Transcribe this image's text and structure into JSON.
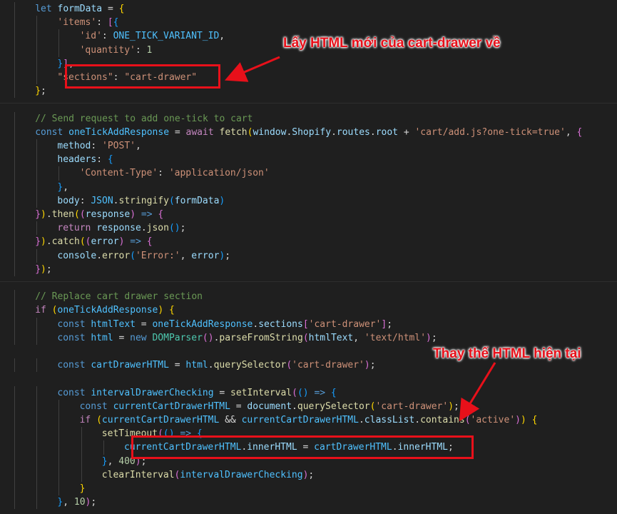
{
  "lines": [
    {
      "indent": 2,
      "tokens": [
        [
          "kw",
          "let"
        ],
        [
          "p",
          " "
        ],
        [
          "var",
          "formData"
        ],
        [
          "p",
          " = "
        ],
        [
          "b1",
          "{"
        ]
      ]
    },
    {
      "indent": 3,
      "tokens": [
        [
          "str",
          "'items'"
        ],
        [
          "p",
          ": "
        ],
        [
          "b2",
          "["
        ],
        [
          "b3",
          "{"
        ]
      ]
    },
    {
      "indent": 4,
      "tokens": [
        [
          "str",
          "'id'"
        ],
        [
          "p",
          ": "
        ],
        [
          "cst",
          "ONE_TICK_VARIANT_ID"
        ],
        [
          "p",
          ","
        ]
      ]
    },
    {
      "indent": 4,
      "tokens": [
        [
          "str",
          "'quantity'"
        ],
        [
          "p",
          ": "
        ],
        [
          "num",
          "1"
        ]
      ]
    },
    {
      "indent": 3,
      "tokens": [
        [
          "b3",
          "}"
        ],
        [
          "b2",
          "]"
        ],
        [
          "p",
          ","
        ]
      ]
    },
    {
      "indent": 3,
      "tokens": [
        [
          "str",
          "\"sections\""
        ],
        [
          "p",
          ": "
        ],
        [
          "str",
          "\"cart-drawer\""
        ]
      ]
    },
    {
      "indent": 2,
      "tokens": [
        [
          "b1",
          "}"
        ],
        [
          "p",
          ";"
        ]
      ]
    },
    {
      "indent": 0,
      "tokens": []
    },
    {
      "indent": 2,
      "tokens": [
        [
          "cmt",
          "// Send request to add one-tick to cart"
        ]
      ]
    },
    {
      "indent": 2,
      "tokens": [
        [
          "kw",
          "const"
        ],
        [
          "p",
          " "
        ],
        [
          "cst",
          "oneTickAddResponse"
        ],
        [
          "p",
          " = "
        ],
        [
          "ctl",
          "await"
        ],
        [
          "p",
          " "
        ],
        [
          "fn",
          "fetch"
        ],
        [
          "b1",
          "("
        ],
        [
          "var",
          "window"
        ],
        [
          "p",
          "."
        ],
        [
          "var",
          "Shopify"
        ],
        [
          "p",
          "."
        ],
        [
          "var",
          "routes"
        ],
        [
          "p",
          "."
        ],
        [
          "var",
          "root"
        ],
        [
          "p",
          " + "
        ],
        [
          "str",
          "'cart/add.js?one-tick=true'"
        ],
        [
          "p",
          ", "
        ],
        [
          "b2",
          "{"
        ]
      ]
    },
    {
      "indent": 3,
      "tokens": [
        [
          "var",
          "method"
        ],
        [
          "p",
          ": "
        ],
        [
          "str",
          "'POST'"
        ],
        [
          "p",
          ","
        ]
      ]
    },
    {
      "indent": 3,
      "tokens": [
        [
          "var",
          "headers"
        ],
        [
          "p",
          ": "
        ],
        [
          "b3",
          "{"
        ]
      ]
    },
    {
      "indent": 4,
      "tokens": [
        [
          "str",
          "'Content-Type'"
        ],
        [
          "p",
          ": "
        ],
        [
          "str",
          "'application/json'"
        ]
      ]
    },
    {
      "indent": 3,
      "tokens": [
        [
          "b3",
          "}"
        ],
        [
          "p",
          ","
        ]
      ]
    },
    {
      "indent": 3,
      "tokens": [
        [
          "var",
          "body"
        ],
        [
          "p",
          ": "
        ],
        [
          "cst",
          "JSON"
        ],
        [
          "p",
          "."
        ],
        [
          "fn",
          "stringify"
        ],
        [
          "b3",
          "("
        ],
        [
          "var",
          "formData"
        ],
        [
          "b3",
          ")"
        ]
      ]
    },
    {
      "indent": 2,
      "tokens": [
        [
          "b2",
          "}"
        ],
        [
          "b1",
          ")"
        ],
        [
          "p",
          "."
        ],
        [
          "fn",
          "then"
        ],
        [
          "b1",
          "("
        ],
        [
          "b2",
          "("
        ],
        [
          "var",
          "response"
        ],
        [
          "b2",
          ")"
        ],
        [
          "p",
          " "
        ],
        [
          "kw",
          "=>"
        ],
        [
          "p",
          " "
        ],
        [
          "b2",
          "{"
        ]
      ]
    },
    {
      "indent": 3,
      "tokens": [
        [
          "ctl",
          "return"
        ],
        [
          "p",
          " "
        ],
        [
          "var",
          "response"
        ],
        [
          "p",
          "."
        ],
        [
          "fn",
          "json"
        ],
        [
          "b3",
          "()"
        ],
        [
          "p",
          ";"
        ]
      ]
    },
    {
      "indent": 2,
      "tokens": [
        [
          "b2",
          "}"
        ],
        [
          "b1",
          ")"
        ],
        [
          "p",
          "."
        ],
        [
          "fn",
          "catch"
        ],
        [
          "b1",
          "("
        ],
        [
          "b2",
          "("
        ],
        [
          "var",
          "error"
        ],
        [
          "b2",
          ")"
        ],
        [
          "p",
          " "
        ],
        [
          "kw",
          "=>"
        ],
        [
          "p",
          " "
        ],
        [
          "b2",
          "{"
        ]
      ]
    },
    {
      "indent": 3,
      "tokens": [
        [
          "var",
          "console"
        ],
        [
          "p",
          "."
        ],
        [
          "fn",
          "error"
        ],
        [
          "b3",
          "("
        ],
        [
          "str",
          "'Error:'"
        ],
        [
          "p",
          ", "
        ],
        [
          "var",
          "error"
        ],
        [
          "b3",
          ")"
        ],
        [
          "p",
          ";"
        ]
      ]
    },
    {
      "indent": 2,
      "tokens": [
        [
          "b2",
          "}"
        ],
        [
          "b1",
          ")"
        ],
        [
          "p",
          ";"
        ]
      ]
    },
    {
      "indent": 0,
      "tokens": []
    },
    {
      "indent": 2,
      "tokens": [
        [
          "cmt",
          "// Replace cart drawer section"
        ]
      ]
    },
    {
      "indent": 2,
      "tokens": [
        [
          "ctl",
          "if"
        ],
        [
          "p",
          " "
        ],
        [
          "b1",
          "("
        ],
        [
          "cst",
          "oneTickAddResponse"
        ],
        [
          "b1",
          ")"
        ],
        [
          "p",
          " "
        ],
        [
          "b1",
          "{"
        ]
      ]
    },
    {
      "indent": 3,
      "tokens": [
        [
          "kw",
          "const"
        ],
        [
          "p",
          " "
        ],
        [
          "cst",
          "htmlText"
        ],
        [
          "p",
          " = "
        ],
        [
          "cst",
          "oneTickAddResponse"
        ],
        [
          "p",
          "."
        ],
        [
          "var",
          "sections"
        ],
        [
          "b2",
          "["
        ],
        [
          "str",
          "'cart-drawer'"
        ],
        [
          "b2",
          "]"
        ],
        [
          "p",
          ";"
        ]
      ]
    },
    {
      "indent": 3,
      "tokens": [
        [
          "kw",
          "const"
        ],
        [
          "p",
          " "
        ],
        [
          "cst",
          "html"
        ],
        [
          "p",
          " = "
        ],
        [
          "kw",
          "new"
        ],
        [
          "p",
          " "
        ],
        [
          "cls",
          "DOMParser"
        ],
        [
          "b2",
          "()"
        ],
        [
          "p",
          "."
        ],
        [
          "fn",
          "parseFromString"
        ],
        [
          "b2",
          "("
        ],
        [
          "var",
          "htmlText"
        ],
        [
          "p",
          ", "
        ],
        [
          "str",
          "'text/html'"
        ],
        [
          "b2",
          ")"
        ],
        [
          "p",
          ";"
        ]
      ]
    },
    {
      "indent": 0,
      "tokens": []
    },
    {
      "indent": 3,
      "tokens": [
        [
          "kw",
          "const"
        ],
        [
          "p",
          " "
        ],
        [
          "cst",
          "cartDrawerHTML"
        ],
        [
          "p",
          " = "
        ],
        [
          "cst",
          "html"
        ],
        [
          "p",
          "."
        ],
        [
          "fn",
          "querySelector"
        ],
        [
          "b2",
          "("
        ],
        [
          "str",
          "'cart-drawer'"
        ],
        [
          "b2",
          ")"
        ],
        [
          "p",
          ";"
        ]
      ]
    },
    {
      "indent": 0,
      "tokens": []
    },
    {
      "indent": 3,
      "tokens": [
        [
          "kw",
          "const"
        ],
        [
          "p",
          " "
        ],
        [
          "cst",
          "intervalDrawerChecking"
        ],
        [
          "p",
          " = "
        ],
        [
          "fn",
          "setInterval"
        ],
        [
          "b2",
          "("
        ],
        [
          "b3",
          "()"
        ],
        [
          "p",
          " "
        ],
        [
          "kw",
          "=>"
        ],
        [
          "p",
          " "
        ],
        [
          "b3",
          "{"
        ]
      ]
    },
    {
      "indent": 4,
      "tokens": [
        [
          "kw",
          "const"
        ],
        [
          "p",
          " "
        ],
        [
          "cst",
          "currentCartDrawerHTML"
        ],
        [
          "p",
          " = "
        ],
        [
          "var",
          "document"
        ],
        [
          "p",
          "."
        ],
        [
          "fn",
          "querySelector"
        ],
        [
          "b1",
          "("
        ],
        [
          "str",
          "'cart-drawer'"
        ],
        [
          "b1",
          ")"
        ],
        [
          "p",
          ";"
        ]
      ]
    },
    {
      "indent": 4,
      "tokens": [
        [
          "ctl",
          "if"
        ],
        [
          "p",
          " "
        ],
        [
          "b1",
          "("
        ],
        [
          "cst",
          "currentCartDrawerHTML"
        ],
        [
          "p",
          " && "
        ],
        [
          "cst",
          "currentCartDrawerHTML"
        ],
        [
          "p",
          "."
        ],
        [
          "var",
          "classList"
        ],
        [
          "p",
          "."
        ],
        [
          "fn",
          "contains"
        ],
        [
          "b2",
          "("
        ],
        [
          "str",
          "'active'"
        ],
        [
          "b2",
          ")"
        ],
        [
          "b1",
          ")"
        ],
        [
          "p",
          " "
        ],
        [
          "b1",
          "{"
        ]
      ]
    },
    {
      "indent": 5,
      "tokens": [
        [
          "fn",
          "setTimeout"
        ],
        [
          "b2",
          "("
        ],
        [
          "b3",
          "()"
        ],
        [
          "p",
          " "
        ],
        [
          "kw",
          "=>"
        ],
        [
          "p",
          " "
        ],
        [
          "b3",
          "{"
        ]
      ]
    },
    {
      "indent": 6,
      "tokens": [
        [
          "cst",
          "currentCartDrawerHTML"
        ],
        [
          "p",
          "."
        ],
        [
          "var",
          "innerHTML"
        ],
        [
          "p",
          " = "
        ],
        [
          "cst",
          "cartDrawerHTML"
        ],
        [
          "p",
          "."
        ],
        [
          "var",
          "innerHTML"
        ],
        [
          "p",
          ";"
        ]
      ]
    },
    {
      "indent": 5,
      "tokens": [
        [
          "b3",
          "}"
        ],
        [
          "p",
          ", "
        ],
        [
          "num",
          "400"
        ],
        [
          "b2",
          ")"
        ],
        [
          "p",
          ";"
        ]
      ]
    },
    {
      "indent": 5,
      "tokens": [
        [
          "fn",
          "clearInterval"
        ],
        [
          "b2",
          "("
        ],
        [
          "cst",
          "intervalDrawerChecking"
        ],
        [
          "b2",
          ")"
        ],
        [
          "p",
          ";"
        ]
      ]
    },
    {
      "indent": 4,
      "tokens": [
        [
          "b1",
          "}"
        ]
      ]
    },
    {
      "indent": 3,
      "tokens": [
        [
          "b3",
          "}"
        ],
        [
          "p",
          ", "
        ],
        [
          "num",
          "10"
        ],
        [
          "b2",
          ")"
        ],
        [
          "p",
          ";"
        ]
      ]
    }
  ],
  "annotations": {
    "top": "Lấy HTML mới của cart-drawer về",
    "bottom": "Thay thế HTML hiện tại"
  },
  "colors": {
    "background": "#1f1f1f",
    "highlight": "#e8101a"
  }
}
